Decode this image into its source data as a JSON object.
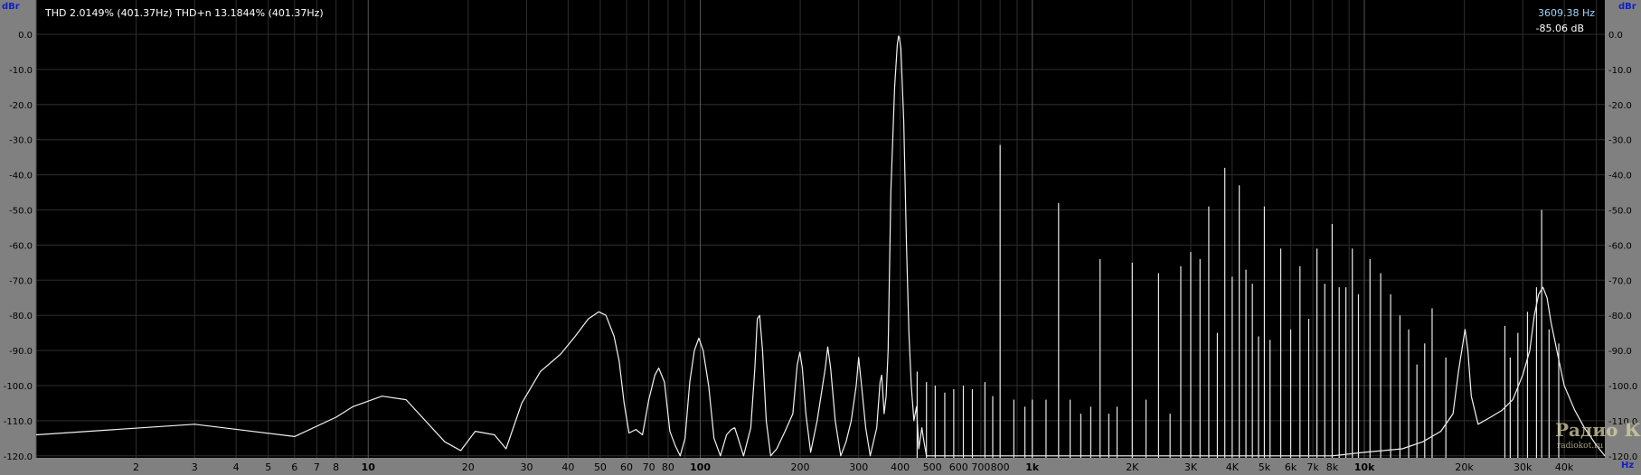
{
  "chart_data": {
    "type": "line",
    "title": "",
    "header": "THD 2.0149% (401.37Hz) THD+n 13.1844% (401.37Hz)",
    "yunit": "dBr",
    "xunit": "Hz",
    "xscale": "log",
    "xlim": [
      1,
      53000
    ],
    "ylim": [
      -120,
      10
    ],
    "grid": true,
    "cursor": {
      "frequency": "3609.38 Hz",
      "level": "-85.06 dB"
    },
    "y_ticks": [
      "0.0",
      "-10.0",
      "-20.0",
      "-30.0",
      "-40.0",
      "-50.0",
      "-60.0",
      "-70.0",
      "-80.0",
      "-90.0",
      "-100.0",
      "-110.0",
      "-120.0"
    ],
    "x_ticks": [
      {
        "f": 2,
        "label": "2"
      },
      {
        "f": 3,
        "label": "3"
      },
      {
        "f": 4,
        "label": "4"
      },
      {
        "f": 5,
        "label": "5"
      },
      {
        "f": 6,
        "label": "6"
      },
      {
        "f": 7,
        "label": "7"
      },
      {
        "f": 8,
        "label": "8"
      },
      {
        "f": 10,
        "label": "10",
        "major": true
      },
      {
        "f": 20,
        "label": "20"
      },
      {
        "f": 30,
        "label": "30"
      },
      {
        "f": 40,
        "label": "40"
      },
      {
        "f": 50,
        "label": "50"
      },
      {
        "f": 60,
        "label": "60"
      },
      {
        "f": 70,
        "label": "70"
      },
      {
        "f": 80,
        "label": "80"
      },
      {
        "f": 100,
        "label": "100",
        "major": true
      },
      {
        "f": 200,
        "label": "200"
      },
      {
        "f": 300,
        "label": "300"
      },
      {
        "f": 400,
        "label": "400"
      },
      {
        "f": 500,
        "label": "500"
      },
      {
        "f": 600,
        "label": "600"
      },
      {
        "f": 700,
        "label": "700"
      },
      {
        "f": 800,
        "label": "800"
      },
      {
        "f": 1000,
        "label": "1k",
        "major": true
      },
      {
        "f": 2000,
        "label": "2K"
      },
      {
        "f": 3000,
        "label": "3K"
      },
      {
        "f": 4000,
        "label": "4K"
      },
      {
        "f": 5000,
        "label": "5k"
      },
      {
        "f": 6000,
        "label": "6k"
      },
      {
        "f": 7000,
        "label": "7k"
      },
      {
        "f": 8000,
        "label": "8k"
      },
      {
        "f": 10000,
        "label": "10k",
        "major": true
      },
      {
        "f": 20000,
        "label": "20k"
      },
      {
        "f": 30000,
        "label": "30k"
      },
      {
        "f": 40000,
        "label": "40k"
      }
    ],
    "series": [
      {
        "values": [
          [
            1,
            -114
          ],
          [
            3,
            -111
          ],
          [
            6,
            -114.5
          ],
          [
            8,
            -109
          ],
          [
            9,
            -106
          ],
          [
            11,
            -103
          ],
          [
            13,
            -104
          ],
          [
            17,
            -116
          ],
          [
            19,
            -118.5
          ],
          [
            21,
            -113
          ],
          [
            24,
            -114
          ],
          [
            26,
            -118
          ],
          [
            29,
            -105
          ],
          [
            33,
            -96
          ],
          [
            38,
            -91
          ],
          [
            42,
            -86
          ],
          [
            46,
            -81
          ],
          [
            49.5,
            -79
          ],
          [
            52,
            -80
          ],
          [
            55,
            -86
          ],
          [
            57,
            -93
          ],
          [
            59,
            -105
          ],
          [
            61,
            -113.5
          ],
          [
            64,
            -112.5
          ],
          [
            67,
            -114
          ],
          [
            70,
            -104
          ],
          [
            73,
            -97
          ],
          [
            75,
            -95
          ],
          [
            78,
            -99
          ],
          [
            81,
            -113
          ],
          [
            84,
            -117
          ],
          [
            87,
            -120
          ],
          [
            90,
            -115
          ],
          [
            93,
            -99
          ],
          [
            96,
            -90
          ],
          [
            99,
            -86.5
          ],
          [
            102,
            -90
          ],
          [
            106,
            -100
          ],
          [
            110,
            -115
          ],
          [
            115,
            -120
          ],
          [
            120,
            -114
          ],
          [
            124,
            -112.5
          ],
          [
            127,
            -112
          ],
          [
            130,
            -115
          ],
          [
            135,
            -120
          ],
          [
            142,
            -112
          ],
          [
            146,
            -95
          ],
          [
            148.5,
            -81
          ],
          [
            151,
            -80
          ],
          [
            154,
            -90
          ],
          [
            158,
            -110
          ],
          [
            163,
            -120
          ],
          [
            170,
            -118
          ],
          [
            180,
            -113
          ],
          [
            190,
            -108
          ],
          [
            196,
            -94
          ],
          [
            199.5,
            -90.5
          ],
          [
            203,
            -95
          ],
          [
            208,
            -108
          ],
          [
            215,
            -119
          ],
          [
            225,
            -110
          ],
          [
            238,
            -95
          ],
          [
            242,
            -89
          ],
          [
            247,
            -95
          ],
          [
            255,
            -110
          ],
          [
            265,
            -120
          ],
          [
            275,
            -116
          ],
          [
            285,
            -110
          ],
          [
            295,
            -100
          ],
          [
            300,
            -92
          ],
          [
            306,
            -100
          ],
          [
            315,
            -112
          ],
          [
            325,
            -120
          ],
          [
            340,
            -112
          ],
          [
            348,
            -99
          ],
          [
            352,
            -97
          ],
          [
            358,
            -108
          ],
          [
            363,
            -103
          ],
          [
            368,
            -90
          ],
          [
            375,
            -45
          ],
          [
            385,
            -15
          ],
          [
            392,
            -3
          ],
          [
            395.5,
            -0.5
          ],
          [
            398,
            -1
          ],
          [
            402,
            -4
          ],
          [
            410,
            -25
          ],
          [
            418,
            -60
          ],
          [
            425,
            -85
          ],
          [
            432,
            -100
          ],
          [
            440,
            -110
          ],
          [
            448,
            -106
          ],
          [
            455,
            -118
          ],
          [
            465,
            -112
          ],
          [
            470,
            -115
          ],
          [
            480,
            -120
          ],
          [
            520,
            -120
          ],
          [
            560,
            -120
          ],
          [
            620,
            -120
          ],
          [
            700,
            -120
          ],
          [
            800,
            -120
          ],
          [
            1000,
            -120
          ],
          [
            2000,
            -120
          ],
          [
            3000,
            -120
          ],
          [
            5000,
            -120
          ],
          [
            8000,
            -120
          ],
          [
            10000,
            -119
          ],
          [
            13000,
            -118
          ],
          [
            15000,
            -116
          ],
          [
            17000,
            -113
          ],
          [
            18500,
            -108
          ],
          [
            19200,
            -96
          ],
          [
            19800,
            -88
          ],
          [
            20100,
            -84
          ],
          [
            20500,
            -90
          ],
          [
            21000,
            -103
          ],
          [
            22000,
            -111
          ],
          [
            24000,
            -109
          ],
          [
            26000,
            -107
          ],
          [
            28000,
            -104
          ],
          [
            30000,
            -97
          ],
          [
            31500,
            -90
          ],
          [
            32500,
            -80
          ],
          [
            33500,
            -74
          ],
          [
            34500,
            -72
          ],
          [
            35500,
            -75
          ],
          [
            36500,
            -82
          ],
          [
            38000,
            -90
          ],
          [
            40000,
            -100
          ],
          [
            43000,
            -107
          ],
          [
            46000,
            -112
          ],
          [
            50000,
            -117
          ],
          [
            53000,
            -120
          ]
        ]
      }
    ],
    "spikes": [
      [
        450,
        -96
      ],
      [
        480,
        -99
      ],
      [
        510,
        -100
      ],
      [
        545,
        -102
      ],
      [
        580,
        -101
      ],
      [
        620,
        -100
      ],
      [
        660,
        -101
      ],
      [
        720,
        -99
      ],
      [
        760,
        -103
      ],
      [
        800,
        -31.5
      ],
      [
        880,
        -104
      ],
      [
        950,
        -106
      ],
      [
        1000,
        -104
      ],
      [
        1100,
        -104
      ],
      [
        1200,
        -48
      ],
      [
        1300,
        -104
      ],
      [
        1400,
        -108
      ],
      [
        1500,
        -106
      ],
      [
        1600,
        -64
      ],
      [
        1700,
        -108
      ],
      [
        1800,
        -106
      ],
      [
        2000,
        -65
      ],
      [
        2200,
        -104
      ],
      [
        2400,
        -68
      ],
      [
        2600,
        -108
      ],
      [
        2800,
        -66
      ],
      [
        3000,
        -62
      ],
      [
        3200,
        -64
      ],
      [
        3400,
        -49
      ],
      [
        3609,
        -85
      ],
      [
        3800,
        -38
      ],
      [
        4000,
        -69
      ],
      [
        4200,
        -43
      ],
      [
        4400,
        -67
      ],
      [
        4600,
        -71
      ],
      [
        4800,
        -86
      ],
      [
        5000,
        -49
      ],
      [
        5200,
        -87
      ],
      [
        5600,
        -61
      ],
      [
        6000,
        -84
      ],
      [
        6400,
        -66
      ],
      [
        6800,
        -81
      ],
      [
        7200,
        -61
      ],
      [
        7600,
        -71
      ],
      [
        8000,
        -54
      ],
      [
        8400,
        -72
      ],
      [
        8800,
        -72
      ],
      [
        9200,
        -61
      ],
      [
        9600,
        -74
      ],
      [
        10400,
        -64
      ],
      [
        11200,
        -68
      ],
      [
        12000,
        -74
      ],
      [
        12800,
        -80
      ],
      [
        13600,
        -84
      ],
      [
        14400,
        -94
      ],
      [
        15200,
        -88
      ],
      [
        16000,
        -78
      ],
      [
        17600,
        -92
      ],
      [
        26500,
        -83
      ],
      [
        27500,
        -92
      ],
      [
        29000,
        -85
      ],
      [
        31000,
        -79
      ],
      [
        33000,
        -72
      ],
      [
        34200,
        -50
      ],
      [
        36000,
        -84
      ],
      [
        38500,
        -88
      ]
    ]
  }
}
